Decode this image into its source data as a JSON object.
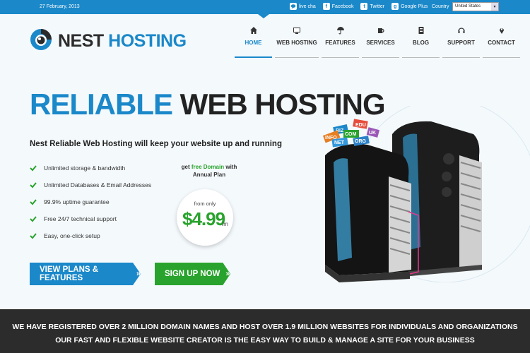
{
  "topbar": {
    "date": "27 February, 2013",
    "links": [
      {
        "icon": "chat-icon",
        "label": "live cha"
      },
      {
        "icon": "facebook-icon",
        "label": "Facebook"
      },
      {
        "icon": "twitter-icon",
        "label": "Twitter"
      },
      {
        "icon": "google-plus-icon",
        "label": "Google Plus"
      }
    ],
    "country_label": "Country",
    "country_value": "United States"
  },
  "logo": {
    "part1": "NEST",
    "part2": "HOSTING"
  },
  "nav": [
    {
      "label": "HOME",
      "icon": "home-icon",
      "active": true
    },
    {
      "label": "WEB HOSTING",
      "icon": "monitor-icon",
      "active": false
    },
    {
      "label": "FEATURES",
      "icon": "umbrella-icon",
      "active": false
    },
    {
      "label": "SERVICES",
      "icon": "mug-icon",
      "active": false
    },
    {
      "label": "BLOG",
      "icon": "document-icon",
      "active": false
    },
    {
      "label": "SUPPORT",
      "icon": "headset-icon",
      "active": false
    },
    {
      "label": "CONTACT",
      "icon": "map-pin-icon",
      "active": false
    }
  ],
  "hero": {
    "headline_1": "RELIABLE",
    "headline_2": "WEB HOSTING",
    "subhead": "Nest Reliable Web Hosting will keep your website up and running",
    "features": [
      "Unlimited storage & bandwidth",
      "Unlimited Databases & Email Addresses",
      "99.9% uptime guarantee",
      "Free 24/7 technical support",
      "Easy, one-click setup"
    ],
    "promo_get": "get",
    "promo_free": "free Domain",
    "promo_with": "with",
    "promo_plan": "Annual Plan",
    "price_from": "from only",
    "price_amount": "$4.99",
    "price_per": "/m",
    "btn_plans": "VIEW PLANS & FEATURES",
    "btn_signup": "SIGN UP NOW"
  },
  "domain_tags": [
    "BIZ",
    "EDU",
    "INFO",
    "COM",
    "NET",
    "ORG",
    "UK"
  ],
  "band": {
    "line1": "WE HAVE REGISTERED OVER 2 MILLION DOMAIN NAMES AND HOST OVER 1.9 MILLION WEBSITES FOR INDIVIDUALS AND ORGANIZATIONS",
    "line2": "OUR FAST AND FLEXIBLE WEBSITE CREATOR IS THE EASY WAY TO BUILD & MANAGE A SITE FOR YOUR BUSINESS"
  },
  "colors": {
    "brand_blue": "#1a88c9",
    "brand_green": "#29a32d",
    "dark": "#2c2c2c"
  }
}
